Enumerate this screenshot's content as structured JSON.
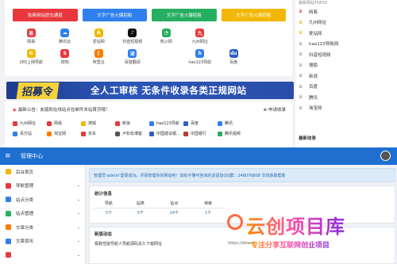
{
  "promo_buttons": [
    "免费网站提交通道",
    "文字广告火爆招租",
    "文字广告火爆招租",
    "文字广告火爆招租"
  ],
  "sites": [
    {
      "label": "网易",
      "icon": "netease-icon",
      "color": "#e8383d",
      "glyph": "易"
    },
    {
      "label": "腾讯云",
      "icon": "tencent-cloud-icon",
      "color": "#2f80ed",
      "glyph": "☁"
    },
    {
      "label": "爱站网",
      "icon": "aizhan-icon",
      "color": "#f2b705",
      "glyph": "A"
    },
    {
      "label": "抖音短视频",
      "icon": "douyin-icon",
      "color": "#111111",
      "glyph": "♪"
    },
    {
      "label": "热火网",
      "icon": "rehuo-icon",
      "color": "#27ae60",
      "glyph": "◔"
    },
    {
      "label": "九州网址",
      "icon": "jiuzhou-icon",
      "color": "#e8383d",
      "glyph": "九"
    },
    {
      "label": "",
      "icon": "blank",
      "color": "#ffffff",
      "glyph": ""
    },
    {
      "label": "",
      "icon": "blank",
      "color": "#ffffff",
      "glyph": ""
    },
    {
      "label": "265上网导航",
      "icon": "265-icon",
      "color": "#f2b705",
      "glyph": "G"
    },
    {
      "label": "搜狗",
      "icon": "sogou-icon",
      "color": "#e8383d",
      "glyph": "S"
    },
    {
      "label": "阿里云",
      "icon": "aliyun-icon",
      "color": "#ff7a00",
      "glyph": "["
    },
    {
      "label": "百度翻译",
      "icon": "baidu-translate-icon",
      "color": "#2f80ed",
      "glyph": "译"
    },
    {
      "label": "",
      "icon": "blank",
      "color": "#ffffff",
      "glyph": ""
    },
    {
      "label": "hao123导航",
      "icon": "hao123-icon",
      "color": "#2f80ed",
      "glyph": "h"
    },
    {
      "label": "百度",
      "icon": "baidu-icon",
      "color": "#2f5ec4",
      "glyph": "du"
    },
    {
      "label": "",
      "icon": "blank",
      "color": "#ffffff",
      "glyph": ""
    }
  ],
  "banner": {
    "highlight": "招募令",
    "text": "全人工审核 无条件收录各类正规网站"
  },
  "notice": "最新公告：友链和在线站点在邮件本站首页哦！",
  "apply_label": "申请收录",
  "links": [
    {
      "label": "九州网址",
      "color": "#e8383d"
    },
    {
      "label": "网易",
      "color": "#e8383d"
    },
    {
      "label": "搜狐",
      "color": "#f2b705"
    },
    {
      "label": "新浪",
      "color": "#e8383d"
    },
    {
      "label": "hao123导航",
      "color": "#2f80ed"
    },
    {
      "label": "百度",
      "color": "#2f5ec4"
    },
    {
      "label": "腾讯",
      "color": "#2f80ed"
    },
    {
      "label": "",
      "color": "#ffffff"
    },
    {
      "label": "百万站",
      "color": "#2f80ed"
    },
    {
      "label": "淘宝网",
      "color": "#ff7a00"
    },
    {
      "label": "京东",
      "color": "#e8383d"
    },
    {
      "label": "卢松松博客",
      "color": "#555555"
    },
    {
      "label": "中国建设银...",
      "color": "#2f5ec4"
    },
    {
      "label": "中国银行",
      "color": "#c0392b"
    },
    {
      "label": "腾讯视频",
      "color": "#27ae60"
    },
    {
      "label": "",
      "color": "#ffffff"
    }
  ],
  "rank_top_tag": "最新网站TOP10",
  "rank": [
    {
      "label": "网易",
      "crown": "#e8383d"
    },
    {
      "label": "九州网址",
      "crown": "#f2b705"
    },
    {
      "label": "爱站网",
      "crown": "#f2b705"
    },
    {
      "label": "hao123导航网",
      "crown": "#999999"
    },
    {
      "label": "抖音短视频",
      "crown": "#999999"
    },
    {
      "label": "搜狐",
      "crown": "#999999"
    },
    {
      "label": "新浪",
      "crown": "#999999"
    },
    {
      "label": "百度",
      "crown": "#999999"
    },
    {
      "label": "腾讯",
      "crown": "#999999"
    },
    {
      "label": "淘宝网",
      "crown": "#999999"
    }
  ],
  "rank_footer": "最新收录",
  "admin": {
    "title": "管理中心",
    "nav": [
      {
        "label": "后台首页",
        "color": "#f2b705",
        "chev": false
      },
      {
        "label": "导航管理",
        "color": "#e8383d",
        "chev": true
      },
      {
        "label": "站点分类",
        "color": "#2f80ed",
        "chev": true
      },
      {
        "label": "站点管理",
        "color": "#27ae60",
        "chev": true
      },
      {
        "label": "文章分类",
        "color": "#ff7a00",
        "chev": true
      },
      {
        "label": "文章资讯",
        "color": "#2f80ed",
        "chev": true
      },
      {
        "label": "",
        "color": "#e8383d",
        "chev": true
      }
    ],
    "alert": "管理员'admin'登录成功，尽情管理你的网站吧！如有不懂可咨询的话请加QQ群：248076808 交流获取帮助",
    "stats_title": "统计信息",
    "stats_headers": [
      "导航",
      "站类",
      "站点",
      "待审"
    ],
    "stats_values": [
      "5",
      "5",
      "24",
      "1"
    ],
    "stats_unit": "个",
    "news_title": "新版动态",
    "news": [
      {
        "title": "极致性能导航人导航源码永久下载网址",
        "url": "https://down"
      },
      {
        "title": "",
        "url": ""
      }
    ]
  },
  "watermark": {
    "big": "云创项目库",
    "small": "专注分享互联网创业项目"
  }
}
